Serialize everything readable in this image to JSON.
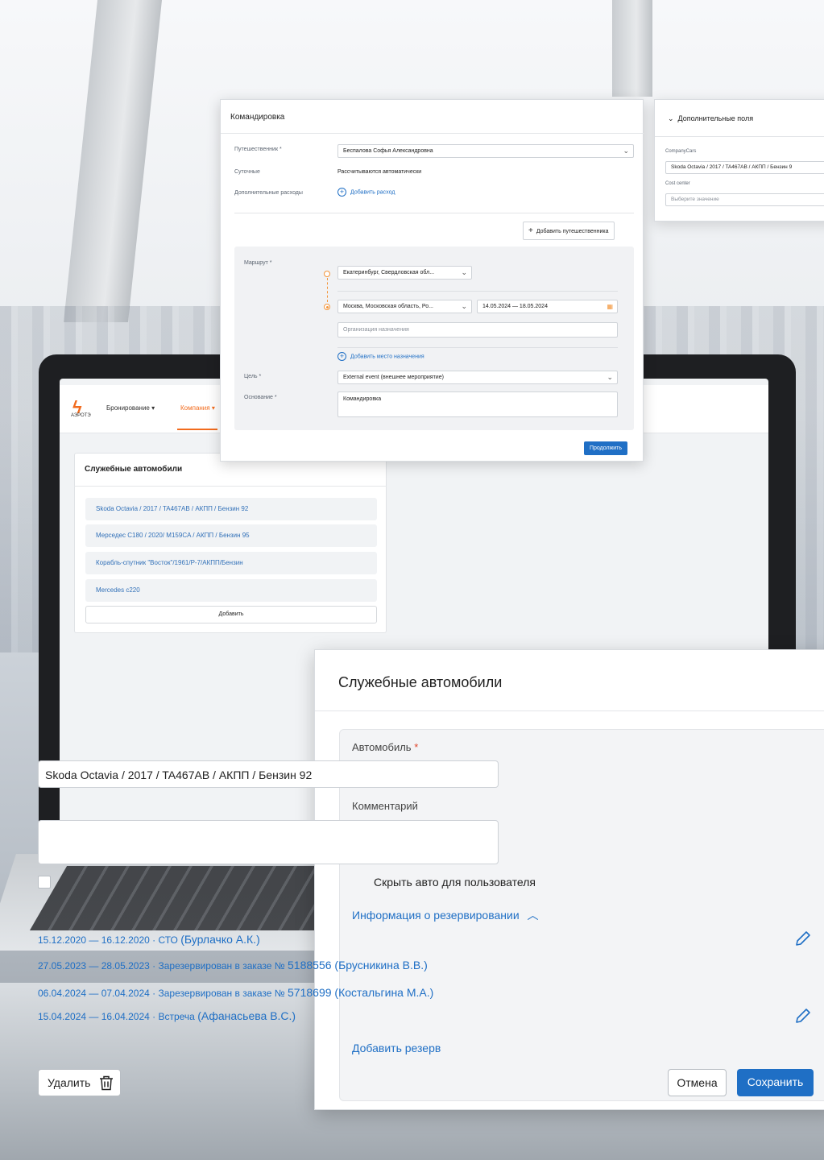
{
  "laptop": {
    "logo_text": "АЭРОТЭ",
    "nav": [
      "Бронирование ▾",
      "Компания ▾"
    ],
    "card_title": "Служебные автомобили",
    "cars": [
      "Skoda Octavia / 2017 / TA467AB / АКПП / Бензин 92",
      "Мерседес C180 / 2020/ M159CA / АКПП / Бензин 95",
      "Корабль-спутник \"Восток\"/1961/Р-7/АКПП/Бензин",
      "Mercedes c220"
    ],
    "add_label": "Добавить"
  },
  "trip": {
    "title": "Командировка",
    "traveler_label": "Путешественник *",
    "traveler_value": "Беспалова Софья Александровна",
    "per_diem_label": "Суточные",
    "per_diem_value": "Рассчитываются автоматически",
    "expenses_label": "Дополнительные расходы",
    "add_expense": "Добавить расход",
    "add_traveler": "Добавить путешественника",
    "route_label": "Маршрут *",
    "from_city": "Екатеринбург, Свердловская обл...",
    "to_city": "Москва, Московская область, Ро...",
    "dates": "14.05.2024 — 18.05.2024",
    "org_placeholder": "Организация назначения",
    "add_destination": "Добавить место назначения",
    "goal_label": "Цель *",
    "goal_value": "External event (внешнее мероприятие)",
    "basis_label": "Основание *",
    "basis_value": "Командировка",
    "continue_label": "Продолжить"
  },
  "extra": {
    "title": "Дополнительные поля",
    "company_cars_label": "CompanyCars",
    "company_cars_value": "Skoda Octavia / 2017 / TA467AB / АКПП / Бензин 9",
    "cost_center_label": "Cost center",
    "cost_center_placeholder": "Выберите значение"
  },
  "cars_dialog": {
    "title": "Служебные автомобили",
    "car_label": "Автомобиль",
    "car_value": "Skoda Octavia / 2017 / TA467AB / АКПП / Бензин 92",
    "comment_label": "Комментарий",
    "comment_value": "",
    "hide_label": "Скрыть авто для пользователя",
    "reservations_label": "Информация о резервировании",
    "reservations": [
      {
        "dates": "15.12.2020 — 16.12.2020",
        "sep": " · ",
        "text": "СТО ",
        "who": "(Бурлачко А.К.)",
        "editable": true
      },
      {
        "dates": "27.05.2023 — 28.05.2023",
        "sep": " · ",
        "text": "Зарезервирован в заказе № ",
        "who": "5188556 (Брусникина В.В.)",
        "editable": false
      },
      {
        "dates": "06.04.2024 — 07.04.2024",
        "sep": " · ",
        "text": "Зарезервирован в заказе № ",
        "who": "5718699 (Костальгина М.А.)",
        "editable": false
      },
      {
        "dates": "15.04.2024 — 16.04.2024",
        "sep": " · ",
        "text": "Встреча ",
        "who": "(Афанасьева В.С.)",
        "editable": true
      }
    ],
    "add_reserve": "Добавить резерв",
    "delete_label": "Удалить",
    "cancel_label": "Отмена",
    "save_label": "Сохранить"
  },
  "colors": {
    "primary": "#1f6fc5",
    "accent": "#f26b1d",
    "route_dot": "#f3953a",
    "required": "#e0452b"
  }
}
